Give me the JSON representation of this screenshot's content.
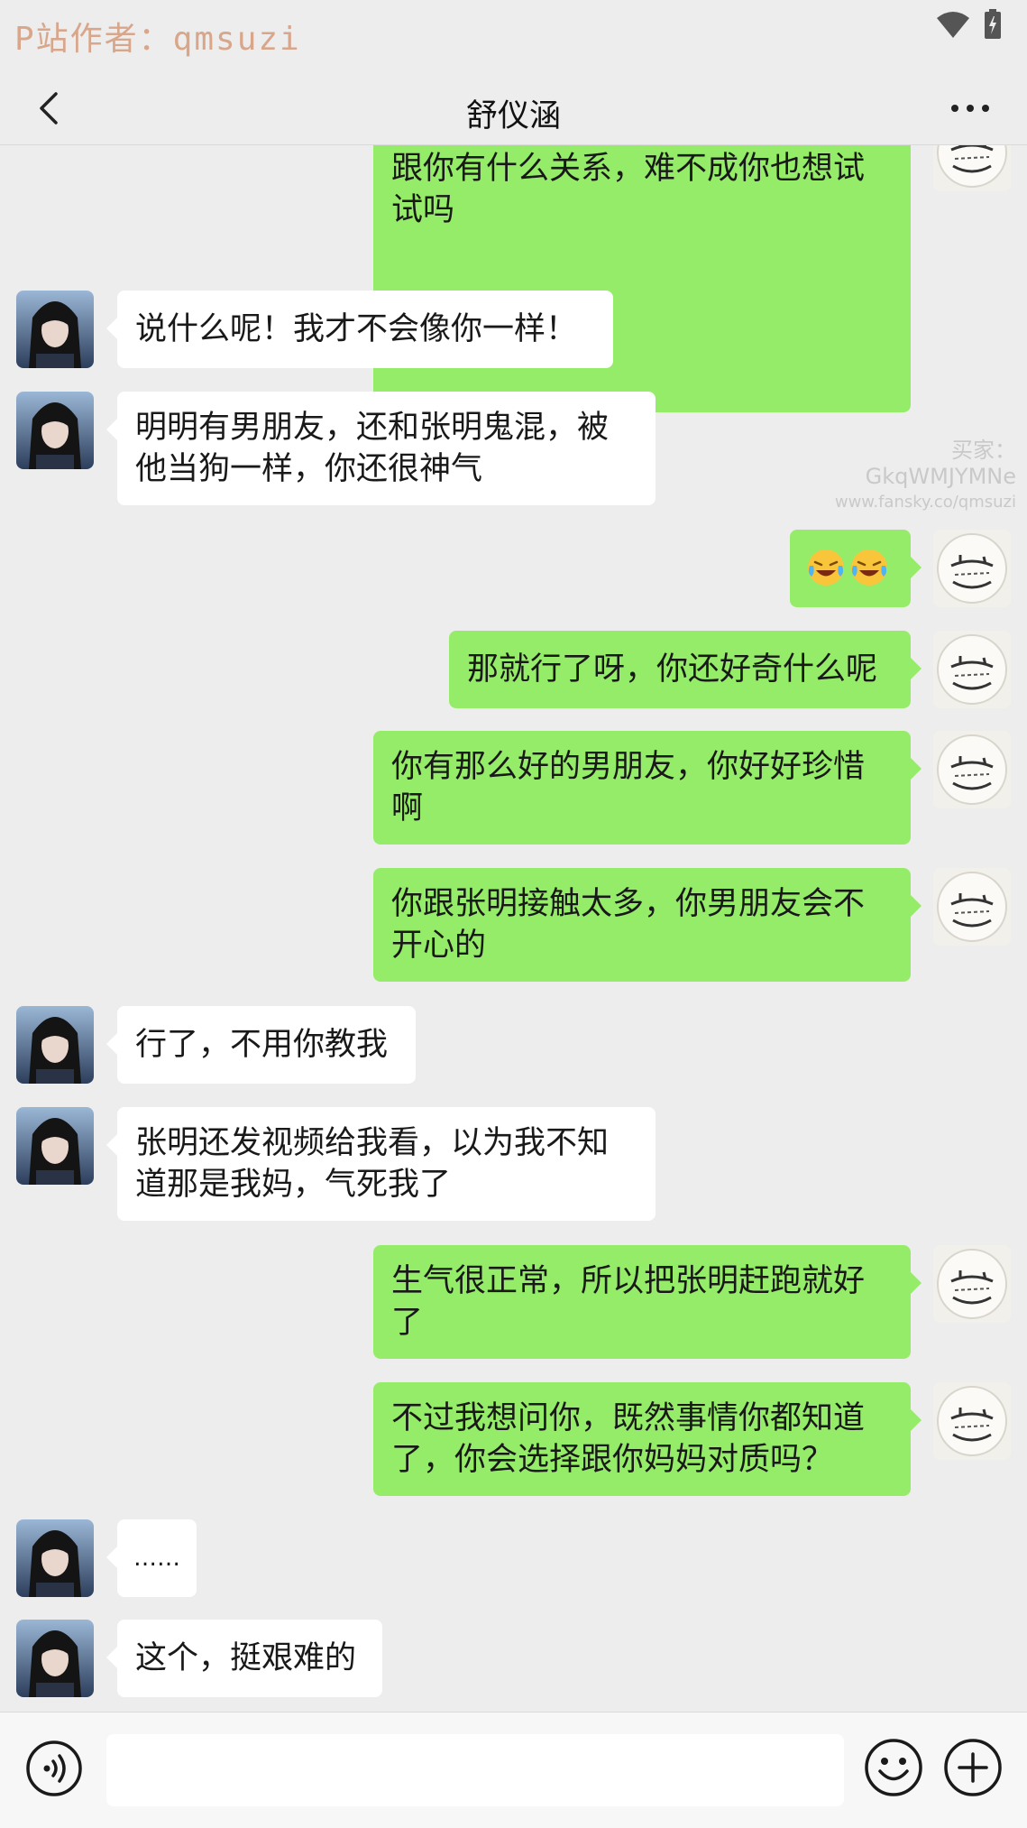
{
  "status_bar": {
    "watermark": "P站作者：qmsuzi",
    "icons": [
      "wifi-icon",
      "battery-icon"
    ]
  },
  "header": {
    "title": "舒仪涵",
    "back_icon": "chevron-left-icon",
    "more_icon": "more-dots-icon"
  },
  "watermark": {
    "buyer": "买家：GkqWMJYMNe",
    "url": "www.fansky.co/qmsuzi"
  },
  "messages": [
    {
      "side": "right",
      "text": "到底是不是因为张明床上功夫好，跟你有什么关系，难不成你也想试试吗",
      "partial": true
    },
    {
      "side": "left",
      "text": "说什么呢！我才不会像你一样！"
    },
    {
      "side": "left",
      "text": "明明有男朋友，还和张明鬼混，被他当狗一样，你还很神气"
    },
    {
      "side": "right",
      "emoji": [
        "crying-laughing-emoji",
        "crying-laughing-emoji"
      ]
    },
    {
      "side": "right",
      "text": "那就行了呀，你还好奇什么呢"
    },
    {
      "side": "right",
      "text": "你有那么好的男朋友，你好好珍惜啊"
    },
    {
      "side": "right",
      "text": "你跟张明接触太多，你男朋友会不开心的"
    },
    {
      "side": "left",
      "text": "行了，不用你教我"
    },
    {
      "side": "left",
      "text": "张明还发视频给我看，以为我不知道那是我妈，气死我了"
    },
    {
      "side": "right",
      "text": "生气很正常，所以把张明赶跑就好了"
    },
    {
      "side": "right",
      "text": "不过我想问你，既然事情你都知道了，你会选择跟你妈妈对质吗？"
    },
    {
      "side": "left",
      "text": "……"
    },
    {
      "side": "left",
      "text": "这个，挺艰难的"
    }
  ],
  "input_bar": {
    "input_value": "",
    "icons": [
      "voice-icon",
      "smiley-icon",
      "plus-circle-icon"
    ]
  },
  "colors": {
    "background": "#EDEDED",
    "bubble_self": "#95EC69",
    "bubble_other": "#FFFFFF",
    "watermark_top": "#D8A68A"
  }
}
